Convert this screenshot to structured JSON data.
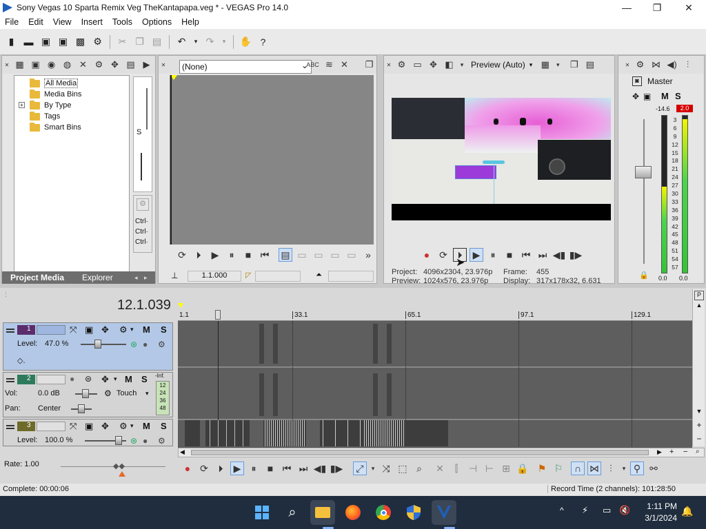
{
  "window": {
    "title": "Sony Vegas 10 Sparta Remix Veg TheKantapapa.veg * - VEGAS Pro 14.0",
    "min": "—",
    "max": "❐",
    "close": "✕"
  },
  "menu": [
    "File",
    "Edit",
    "View",
    "Insert",
    "Tools",
    "Options",
    "Help"
  ],
  "media": {
    "tree": [
      "All Media",
      "Media Bins",
      "By Type",
      "Tags",
      "Smart Bins"
    ],
    "expander": "+",
    "tabs": [
      "Project Media",
      "Explorer"
    ],
    "side_items": [
      "S",
      "Ctrl·",
      "Ctrl·",
      "Ctrl·"
    ]
  },
  "trimmer": {
    "combo_value": "(None)",
    "time_value": "1.1.000"
  },
  "preview": {
    "mode": "Preview (Auto)",
    "project_label": "Project:",
    "project_value": "4096x2304, 23.976p",
    "preview_label": "Preview:",
    "preview_value": "1024x576, 23.976p",
    "frame_label": "Frame:",
    "frame_value": "455",
    "display_label": "Display:",
    "display_value": "317x178x32, 6.631"
  },
  "master": {
    "title": "Master",
    "m": "M",
    "s": "S",
    "peak_left": "-14.6",
    "peak_right": "2.0",
    "scale": [
      "3",
      "6",
      "9",
      "12",
      "15",
      "18",
      "21",
      "24",
      "27",
      "30",
      "33",
      "36",
      "39",
      "42",
      "45",
      "48",
      "51",
      "54",
      "57"
    ],
    "bottom_left": "0.0",
    "bottom_right": "0.0"
  },
  "timeline": {
    "cursor_time": "12.1.039",
    "ruler": [
      "1.1",
      "33.1",
      "65.1",
      "97.1",
      "129.1"
    ],
    "rate_label": "Rate: 1.00"
  },
  "tracks": [
    {
      "num": "1",
      "m": "M",
      "s": "S",
      "level_label": "Level:",
      "level_value": "47.0 %"
    },
    {
      "num": "2",
      "m": "M",
      "s": "S",
      "vol_label": "Vol:",
      "vol_value": "0.0 dB",
      "pan_label": "Pan:",
      "pan_value": "Center",
      "touch": "Touch",
      "inf": "-Inf.",
      "meter_nums": [
        "12",
        "24",
        "36",
        "48"
      ]
    },
    {
      "num": "3",
      "m": "M",
      "s": "S",
      "level_label": "Level:",
      "level_value": "100.0 %"
    }
  ],
  "status": {
    "complete": "Complete: 00:00:06",
    "record": "Record Time (2 channels): 101:28:50"
  },
  "taskbar": {
    "time": "1:11 PM",
    "date": "3/1/2024"
  }
}
